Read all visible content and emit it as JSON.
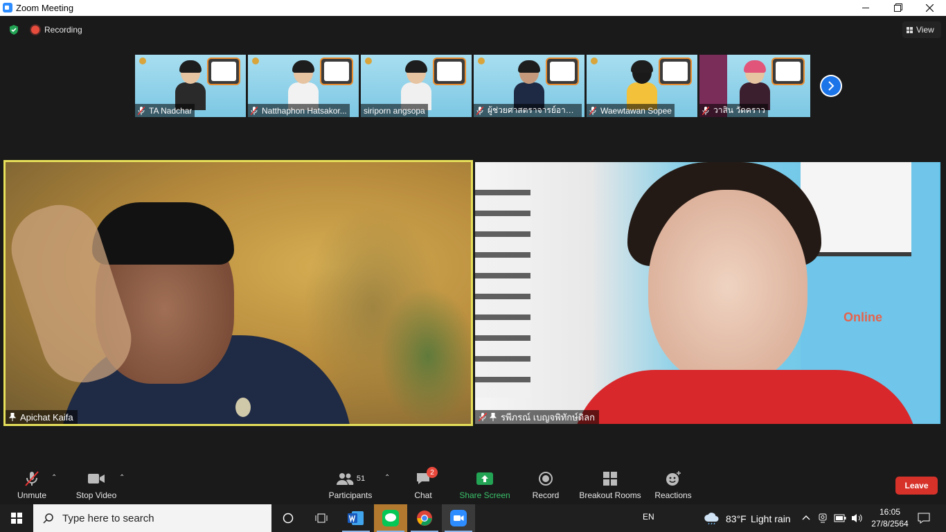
{
  "window": {
    "title": "Zoom Meeting"
  },
  "topbar": {
    "recording_label": "Recording",
    "view_label": "View"
  },
  "thumbnails": [
    {
      "name": "TA Nadchar"
    },
    {
      "name": "Natthaphon Hatsakor..."
    },
    {
      "name": "siriporn angsopa"
    },
    {
      "name": "ผู้ช่วยศาสตราจารย์อานน..."
    },
    {
      "name": "Waewtawan Sopee"
    },
    {
      "name": "วาสิน วัดคราว"
    }
  ],
  "videos": [
    {
      "name": "Apichat Kaifa",
      "active_speaker": true,
      "muted": false
    },
    {
      "name": "รพีภรณ์ เบญจพิทักษ์ดิลก",
      "active_speaker": false,
      "muted": true
    }
  ],
  "video2_overlay_text": "Online",
  "toolbar": {
    "unmute": "Unmute",
    "stop_video": "Stop Video",
    "participants": "Participants",
    "participants_count": "51",
    "chat": "Chat",
    "chat_badge": "2",
    "share_screen": "Share Screen",
    "record": "Record",
    "breakout_rooms": "Breakout Rooms",
    "reactions": "Reactions",
    "leave": "Leave"
  },
  "taskbar": {
    "search_placeholder": "Type here to search",
    "language": "EN",
    "weather_temp": "83°F",
    "weather_desc": "Light rain",
    "time": "16:05",
    "date": "27/8/2564"
  },
  "colors": {
    "active_speaker_border": "#e6e05a",
    "leave_button": "#d7322a",
    "share_screen": "#3ac26a",
    "recording_dot": "#e74c3c"
  }
}
